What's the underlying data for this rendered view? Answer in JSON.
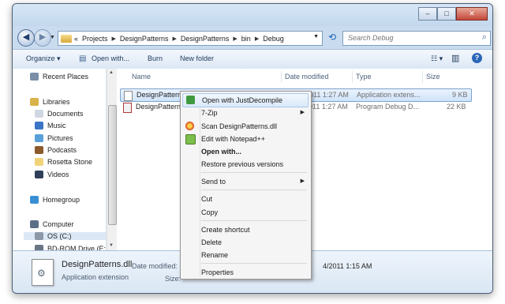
{
  "window": {
    "caption_buttons": {
      "minimize": "–",
      "maximize": "□",
      "close": "✕"
    }
  },
  "navigation": {
    "back_glyph": "◀",
    "forward_glyph": "▶",
    "breadcrumb_lead": "«",
    "breadcrumb": [
      "Projects",
      "DesignPatterns",
      "DesignPatterns",
      "bin",
      "Debug"
    ],
    "refresh_glyph": "⟲",
    "search_placeholder": "Search Debug"
  },
  "toolbar": {
    "organize": "Organize ▾",
    "open_with": "Open with...",
    "burn": "Burn",
    "new_folder": "New folder",
    "view_glyph": "☷ ▾",
    "pane_glyph": "▥",
    "help_glyph": "?"
  },
  "sidebar": {
    "items": [
      {
        "label": "Recent Places",
        "icon": "recent-places-icon",
        "color": "#7a8fa6"
      },
      {
        "label": "Libraries",
        "icon": "libraries-icon",
        "color": "#d9b24a"
      },
      {
        "label": "Documents",
        "icon": "documents-icon",
        "color": "#cfd7e2"
      },
      {
        "label": "Music",
        "icon": "music-icon",
        "color": "#3b74c7"
      },
      {
        "label": "Pictures",
        "icon": "pictures-icon",
        "color": "#5aa0d8"
      },
      {
        "label": "Podcasts",
        "icon": "podcasts-icon",
        "color": "#8a5a2b"
      },
      {
        "label": "Rosetta Stone",
        "icon": "rosetta-stone-icon",
        "color": "#f1d37a"
      },
      {
        "label": "Videos",
        "icon": "videos-icon",
        "color": "#2f3f5a"
      },
      {
        "label": "Homegroup",
        "icon": "homegroup-icon",
        "color": "#3a8fd4"
      },
      {
        "label": "Computer",
        "icon": "computer-icon",
        "color": "#5d6f86"
      },
      {
        "label": "OS (C:)",
        "icon": "drive-icon",
        "color": "#8c98a8"
      },
      {
        "label": "BD-ROM Drive (E:",
        "icon": "bd-rom-icon",
        "color": "#6a7585"
      }
    ]
  },
  "file_list": {
    "columns": [
      "Name",
      "Date modified",
      "Type",
      "Size"
    ],
    "rows": [
      {
        "name": "DesignPatterns.dll",
        "date": "10/24/2011 1:27 AM",
        "type": "Application extens...",
        "size": "9 KB"
      },
      {
        "name": "DesignPatterns.",
        "date": "10/24/2011 1:27 AM",
        "type": "Program Debug D...",
        "size": "22 KB"
      }
    ]
  },
  "details_pane": {
    "file_name": "DesignPatterns.dll",
    "file_type": "Application extension",
    "date_label": "Date modified:",
    "date_value": "4/2011 1:15 AM",
    "size_label": "Size:"
  },
  "context_menu": {
    "items": [
      {
        "label": "Open with JustDecompile"
      },
      {
        "label": "7-Zip"
      },
      {
        "label": "Scan DesignPatterns.dll"
      },
      {
        "label": "Edit with Notepad++"
      },
      {
        "label": "Open with..."
      },
      {
        "label": "Restore previous versions"
      },
      {
        "label": "Send to"
      },
      {
        "label": "Cut"
      },
      {
        "label": "Copy"
      },
      {
        "label": "Create shortcut"
      },
      {
        "label": "Delete"
      },
      {
        "label": "Rename"
      },
      {
        "label": "Properties"
      }
    ]
  },
  "colors": {
    "chrome": "#c9dcef",
    "selection": "#cfe3fa",
    "menu_highlight": "#dbe9f9",
    "close_red": "#c3473a"
  }
}
